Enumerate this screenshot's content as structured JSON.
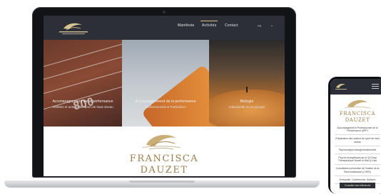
{
  "website": {
    "nav": {
      "links": [
        "Manifeste",
        "Activités",
        "Contact"
      ],
      "active_index": 1,
      "lang": "FR"
    },
    "panels": [
      {
        "title": "Accompagnement de la performance",
        "subtitle": "Athlètes et acteurs du sport de haut niveau",
        "track_number": "800"
      },
      {
        "title": "Accompagnement de la performance",
        "subtitle": "Professionnels & Particuliers"
      },
      {
        "title": "Biologie",
        "subtitle": "Individuelle ou en groupe"
      }
    ],
    "brand": {
      "line1": "FRANCISCA",
      "line2": "DAUZET"
    }
  },
  "phone": {
    "brand": {
      "line1": "FRANCISCA",
      "line2": "DAUZET"
    },
    "menu": [
      "Accompagnement Professionnel de la Performance (APP)",
      "Préparation des acteurs du sport de haut niveau",
      "Psychanalyse transgénérationnelle",
      "Psycho-énergétique par le Qi Gong Thérapeutique Nuwei et Wai Qi Liao",
      "Consultation préventive de l'institut de la Reconnaissance (CHSE)",
      "Entreprise, Conférences, Autisme"
    ],
    "button": "Consulter mes références"
  },
  "colors": {
    "accent": "#9b7d4c",
    "nav": "#2c2f37",
    "gold_line": "#d8c08a"
  }
}
